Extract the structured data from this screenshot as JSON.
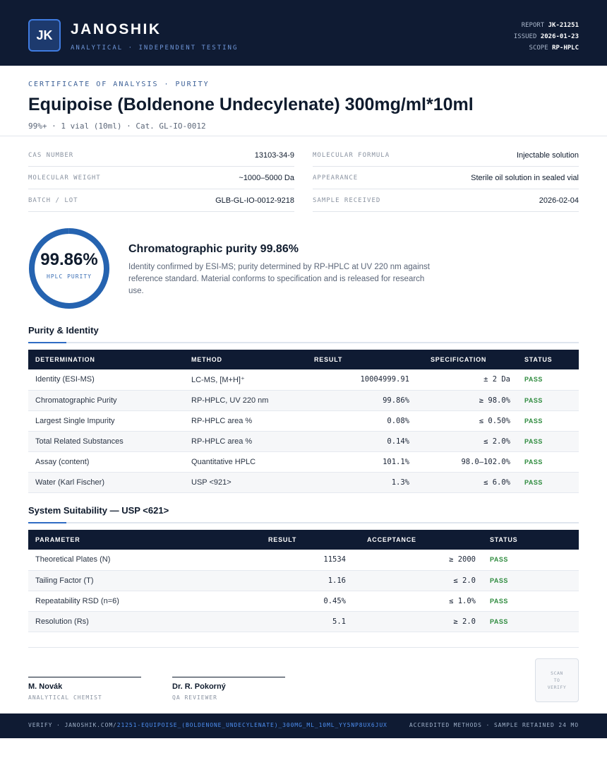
{
  "header": {
    "logo": "JK",
    "brand": "JANOSHIK",
    "brand_sub": "ANALYTICAL · INDEPENDENT TESTING",
    "report_label": "REPORT",
    "report_value": "JK-21251",
    "issued_label": "ISSUED",
    "issued_value": "2026-01-23",
    "scope_label": "SCOPE",
    "scope_value": "RP-HPLC"
  },
  "certificate": {
    "kicker": "CERTIFICATE OF ANALYSIS · PURITY",
    "title": "Equipoise (Boldenone Undecylenate) 300mg/ml*10ml",
    "subtitle": "99%+ · 1 vial (10ml)  ·  Cat. GL-IO-0012"
  },
  "info_left": [
    {
      "label": "CAS NUMBER",
      "value": "13103-34-9"
    },
    {
      "label": "MOLECULAR WEIGHT",
      "value": "~1000–5000 Da"
    },
    {
      "label": "BATCH / LOT",
      "value": "GLB-GL-IO-0012-9218"
    }
  ],
  "info_right": [
    {
      "label": "MOLECULAR FORMULA",
      "value": "Injectable solution"
    },
    {
      "label": "APPEARANCE",
      "value": "Sterile oil solution in sealed vial"
    },
    {
      "label": "SAMPLE RECEIVED",
      "value": "2026-02-04"
    }
  ],
  "purity": {
    "value": "99.86%",
    "fraction": 0.9986,
    "label": "HPLC PURITY",
    "heading": "Chromatographic purity 99.86%",
    "text": "Identity confirmed by ESI-MS; purity determined by RP-HPLC at UV 220 nm against reference standard. Material conforms to specification and is released for research use.",
    "ring_color": "#2563b0"
  },
  "purity_identity": {
    "title": "Purity & Identity",
    "headers": [
      "DETERMINATION",
      "METHOD",
      "RESULT",
      "SPECIFICATION",
      "STATUS"
    ],
    "rows": [
      [
        "Identity (ESI-MS)",
        "LC-MS, [M+H]⁺",
        "10004999.91",
        "± 2 Da",
        "PASS"
      ],
      [
        "Chromatographic Purity",
        "RP-HPLC, UV 220 nm",
        "99.86%",
        "≥ 98.0%",
        "PASS"
      ],
      [
        "Largest Single Impurity",
        "RP-HPLC area %",
        "0.08%",
        "≤ 0.50%",
        "PASS"
      ],
      [
        "Total Related Substances",
        "RP-HPLC area %",
        "0.14%",
        "≤ 2.0%",
        "PASS"
      ],
      [
        "Assay (content)",
        "Quantitative HPLC",
        "101.1%",
        "98.0–102.0%",
        "PASS"
      ],
      [
        "Water (Karl Fischer)",
        "USP <921>",
        "1.3%",
        "≤ 6.0%",
        "PASS"
      ]
    ]
  },
  "system_suitability": {
    "title": "System Suitability — USP <621>",
    "headers": [
      "PARAMETER",
      "RESULT",
      "ACCEPTANCE",
      "STATUS"
    ],
    "rows": [
      [
        "Theoretical Plates (N)",
        "11534",
        "≥ 2000",
        "PASS"
      ],
      [
        "Tailing Factor (T)",
        "1.16",
        "≤ 2.0",
        "PASS"
      ],
      [
        "Repeatability RSD (n=6)",
        "0.45%",
        "≤ 1.0%",
        "PASS"
      ],
      [
        "Resolution (Rs)",
        "5.1",
        "≥ 2.0",
        "PASS"
      ]
    ]
  },
  "signatures": [
    {
      "name": "M. Novák",
      "role": "ANALYTICAL CHEMIST"
    },
    {
      "name": "Dr. R. Pokorný",
      "role": "QA REVIEWER"
    }
  ],
  "qr": {
    "line1": "SCAN",
    "line2": "TO",
    "line3": "VERIFY"
  },
  "footer": {
    "verify_prefix": "VERIFY · JANOSHIK.COM/",
    "verify_link": "21251-EQUIPOISE_(BOLDENONE_UNDECYLENATE)_300MG_ML_10ML_YY5NP8UX6JUX",
    "right": "ACCREDITED METHODS · SAMPLE RETAINED 24 MO"
  }
}
